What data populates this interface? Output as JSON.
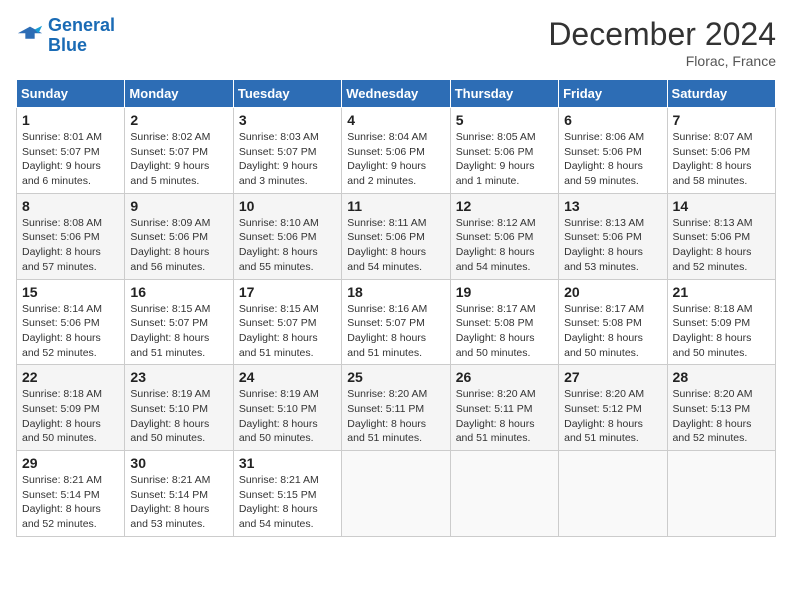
{
  "header": {
    "logo_line1": "General",
    "logo_line2": "Blue",
    "month_title": "December 2024",
    "location": "Florac, France"
  },
  "calendar": {
    "weekdays": [
      "Sunday",
      "Monday",
      "Tuesday",
      "Wednesday",
      "Thursday",
      "Friday",
      "Saturday"
    ],
    "weeks": [
      [
        {
          "day": "1",
          "sunrise": "8:01 AM",
          "sunset": "5:07 PM",
          "daylight": "9 hours and 6 minutes."
        },
        {
          "day": "2",
          "sunrise": "8:02 AM",
          "sunset": "5:07 PM",
          "daylight": "9 hours and 5 minutes."
        },
        {
          "day": "3",
          "sunrise": "8:03 AM",
          "sunset": "5:07 PM",
          "daylight": "9 hours and 3 minutes."
        },
        {
          "day": "4",
          "sunrise": "8:04 AM",
          "sunset": "5:06 PM",
          "daylight": "9 hours and 2 minutes."
        },
        {
          "day": "5",
          "sunrise": "8:05 AM",
          "sunset": "5:06 PM",
          "daylight": "9 hours and 1 minute."
        },
        {
          "day": "6",
          "sunrise": "8:06 AM",
          "sunset": "5:06 PM",
          "daylight": "8 hours and 59 minutes."
        },
        {
          "day": "7",
          "sunrise": "8:07 AM",
          "sunset": "5:06 PM",
          "daylight": "8 hours and 58 minutes."
        }
      ],
      [
        {
          "day": "8",
          "sunrise": "8:08 AM",
          "sunset": "5:06 PM",
          "daylight": "8 hours and 57 minutes."
        },
        {
          "day": "9",
          "sunrise": "8:09 AM",
          "sunset": "5:06 PM",
          "daylight": "8 hours and 56 minutes."
        },
        {
          "day": "10",
          "sunrise": "8:10 AM",
          "sunset": "5:06 PM",
          "daylight": "8 hours and 55 minutes."
        },
        {
          "day": "11",
          "sunrise": "8:11 AM",
          "sunset": "5:06 PM",
          "daylight": "8 hours and 54 minutes."
        },
        {
          "day": "12",
          "sunrise": "8:12 AM",
          "sunset": "5:06 PM",
          "daylight": "8 hours and 54 minutes."
        },
        {
          "day": "13",
          "sunrise": "8:13 AM",
          "sunset": "5:06 PM",
          "daylight": "8 hours and 53 minutes."
        },
        {
          "day": "14",
          "sunrise": "8:13 AM",
          "sunset": "5:06 PM",
          "daylight": "8 hours and 52 minutes."
        }
      ],
      [
        {
          "day": "15",
          "sunrise": "8:14 AM",
          "sunset": "5:06 PM",
          "daylight": "8 hours and 52 minutes."
        },
        {
          "day": "16",
          "sunrise": "8:15 AM",
          "sunset": "5:07 PM",
          "daylight": "8 hours and 51 minutes."
        },
        {
          "day": "17",
          "sunrise": "8:15 AM",
          "sunset": "5:07 PM",
          "daylight": "8 hours and 51 minutes."
        },
        {
          "day": "18",
          "sunrise": "8:16 AM",
          "sunset": "5:07 PM",
          "daylight": "8 hours and 51 minutes."
        },
        {
          "day": "19",
          "sunrise": "8:17 AM",
          "sunset": "5:08 PM",
          "daylight": "8 hours and 50 minutes."
        },
        {
          "day": "20",
          "sunrise": "8:17 AM",
          "sunset": "5:08 PM",
          "daylight": "8 hours and 50 minutes."
        },
        {
          "day": "21",
          "sunrise": "8:18 AM",
          "sunset": "5:09 PM",
          "daylight": "8 hours and 50 minutes."
        }
      ],
      [
        {
          "day": "22",
          "sunrise": "8:18 AM",
          "sunset": "5:09 PM",
          "daylight": "8 hours and 50 minutes."
        },
        {
          "day": "23",
          "sunrise": "8:19 AM",
          "sunset": "5:10 PM",
          "daylight": "8 hours and 50 minutes."
        },
        {
          "day": "24",
          "sunrise": "8:19 AM",
          "sunset": "5:10 PM",
          "daylight": "8 hours and 50 minutes."
        },
        {
          "day": "25",
          "sunrise": "8:20 AM",
          "sunset": "5:11 PM",
          "daylight": "8 hours and 51 minutes."
        },
        {
          "day": "26",
          "sunrise": "8:20 AM",
          "sunset": "5:11 PM",
          "daylight": "8 hours and 51 minutes."
        },
        {
          "day": "27",
          "sunrise": "8:20 AM",
          "sunset": "5:12 PM",
          "daylight": "8 hours and 51 minutes."
        },
        {
          "day": "28",
          "sunrise": "8:20 AM",
          "sunset": "5:13 PM",
          "daylight": "8 hours and 52 minutes."
        }
      ],
      [
        {
          "day": "29",
          "sunrise": "8:21 AM",
          "sunset": "5:14 PM",
          "daylight": "8 hours and 52 minutes."
        },
        {
          "day": "30",
          "sunrise": "8:21 AM",
          "sunset": "5:14 PM",
          "daylight": "8 hours and 53 minutes."
        },
        {
          "day": "31",
          "sunrise": "8:21 AM",
          "sunset": "5:15 PM",
          "daylight": "8 hours and 54 minutes."
        },
        null,
        null,
        null,
        null
      ]
    ]
  }
}
